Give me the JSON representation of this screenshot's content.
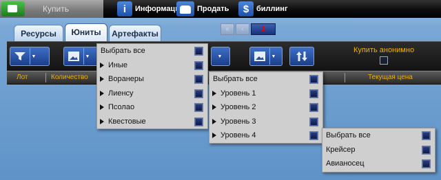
{
  "topbar": {
    "buy_label": "Купить",
    "info_label": "Информация",
    "sell_label": "Продать",
    "billing_label": "биллинг",
    "info_icon": "i",
    "billing_icon": "$"
  },
  "tabs": [
    {
      "label": "Ресурсы"
    },
    {
      "label": "Юниты"
    },
    {
      "label": "Артефакты"
    }
  ],
  "pager": {
    "first": "«",
    "prev": "‹",
    "current": "1"
  },
  "toolbar": {
    "anonymous_label": "Купить анонимно"
  },
  "table": {
    "headers": [
      "Лот",
      "Количество",
      "Текущая цена"
    ]
  },
  "menu1": {
    "items": [
      {
        "label": "Выбрать все"
      },
      {
        "label": "Иные"
      },
      {
        "label": "Воранеры"
      },
      {
        "label": "Лиенсу"
      },
      {
        "label": "Псолао"
      },
      {
        "label": "Квестовые"
      }
    ]
  },
  "menu2": {
    "items": [
      {
        "label": "Выбрать все"
      },
      {
        "label": "Уровень 1"
      },
      {
        "label": "Уровень 2"
      },
      {
        "label": "Уровень 3"
      },
      {
        "label": "Уровень 4"
      }
    ]
  },
  "menu3": {
    "items": [
      {
        "label": "Выбрать все"
      },
      {
        "label": "Крейсер"
      },
      {
        "label": "Авианосец"
      }
    ]
  },
  "colors": {
    "accent": "#f0b000",
    "checkbox": "#1b2a6b"
  }
}
